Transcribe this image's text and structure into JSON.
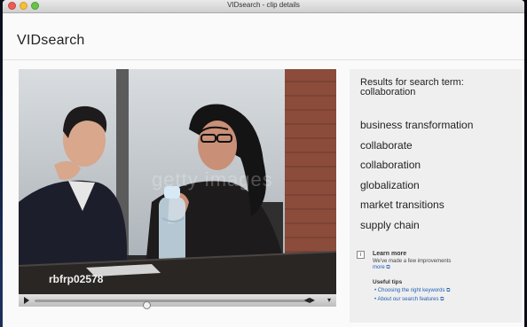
{
  "window": {
    "title": "VIDsearch - clip details"
  },
  "app": {
    "logo": "VIDsearch"
  },
  "video": {
    "clip_id": "rbfrp02578",
    "watermark": "getty images",
    "progress": 0.41
  },
  "results": {
    "heading": "Results for search term: collaboration",
    "terms": [
      "business transformation",
      "collaborate",
      "collaboration",
      "globalization",
      "market transitions",
      "supply chain"
    ]
  },
  "info": {
    "learn_title": "Learn more",
    "learn_text": "We've made a few improvements",
    "learn_more_link": "more",
    "tips_title": "Useful tips",
    "tips": [
      "Choosing the right keywords",
      "About our search features"
    ]
  },
  "icons": {
    "play": "play-icon",
    "volume": "volume-icon",
    "menu": "menu-icon",
    "info": "info-icon",
    "external": "external-link-icon"
  }
}
